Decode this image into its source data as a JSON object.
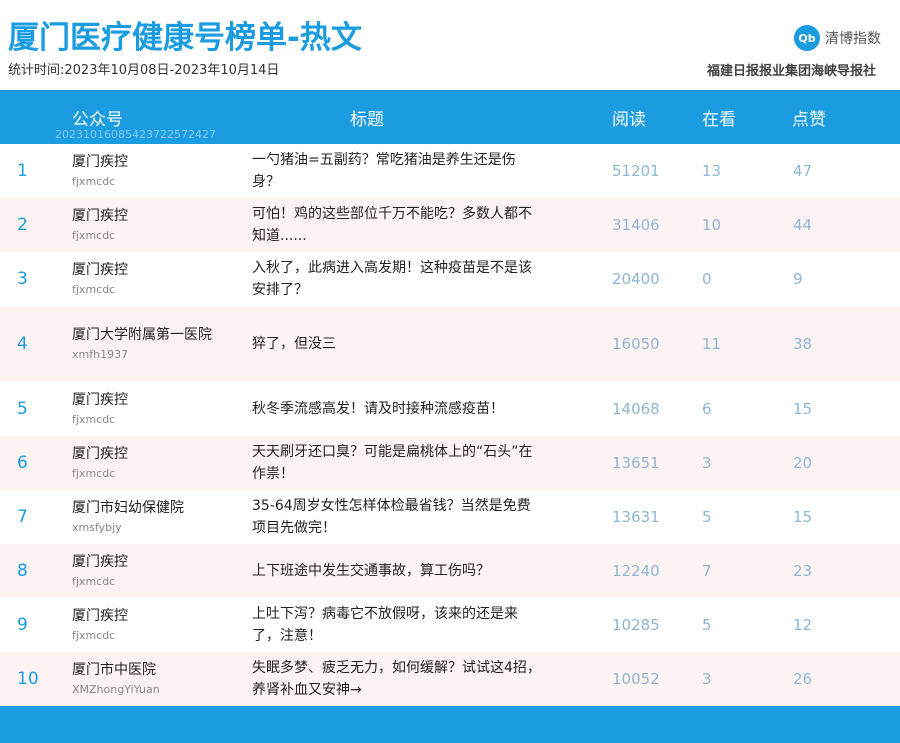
{
  "header": {
    "title": "厦门医疗健康号榜单-热文",
    "period": "统计时间:2023年10月08日-2023年10月14日",
    "logo_mark": "Qb",
    "logo_text": "清博指数",
    "publisher": "福建日报报业集团海峡导报社"
  },
  "table": {
    "columns": {
      "account": "公众号",
      "title": "标题",
      "reads": "阅读",
      "watching": "在看",
      "likes": "点赞"
    },
    "stamp": "20231016085423722572427",
    "rows": [
      {
        "rank": "1",
        "account": "厦门疾控",
        "account_id": "fjxmcdc",
        "title": "一勺猪油=五副药？常吃猪油是养生还是伤身？",
        "reads": "51201",
        "watching": "13",
        "likes": "47"
      },
      {
        "rank": "2",
        "account": "厦门疾控",
        "account_id": "fjxmcdc",
        "title": "可怕！鸡的这些部位千万不能吃？多数人都不知道......",
        "reads": "31406",
        "watching": "10",
        "likes": "44"
      },
      {
        "rank": "3",
        "account": "厦门疾控",
        "account_id": "fjxmcdc",
        "title": "入秋了，此病进入高发期！这种疫苗是不是该安排了？",
        "reads": "20400",
        "watching": "0",
        "likes": "9"
      },
      {
        "rank": "4",
        "account": "厦门大学附属第一医院",
        "account_id": "xmfh1937",
        "title": "猝了，但没三",
        "reads": "16050",
        "watching": "11",
        "likes": "38"
      },
      {
        "rank": "5",
        "account": "厦门疾控",
        "account_id": "fjxmcdc",
        "title": "秋冬季流感高发！请及时接种流感疫苗！",
        "reads": "14068",
        "watching": "6",
        "likes": "15"
      },
      {
        "rank": "6",
        "account": "厦门疾控",
        "account_id": "fjxmcdc",
        "title": "天天刷牙还口臭？可能是扁桃体上的“石头”在作祟！",
        "reads": "13651",
        "watching": "3",
        "likes": "20"
      },
      {
        "rank": "7",
        "account": "厦门市妇幼保健院",
        "account_id": "xmsfybjy",
        "title": "35-64周岁女性怎样体检最省钱？当然是免费项目先做完！",
        "reads": "13631",
        "watching": "5",
        "likes": "15"
      },
      {
        "rank": "8",
        "account": "厦门疾控",
        "account_id": "fjxmcdc",
        "title": "上下班途中发生交通事故，算工伤吗？",
        "reads": "12240",
        "watching": "7",
        "likes": "23"
      },
      {
        "rank": "9",
        "account": "厦门疾控",
        "account_id": "fjxmcdc",
        "title": "上吐下泻？病毒它不放假呀，该来的还是来了，注意！",
        "reads": "10285",
        "watching": "5",
        "likes": "12"
      },
      {
        "rank": "10",
        "account": "厦门市中医院",
        "account_id": "XMZhongYiYuan",
        "title": "失眠多梦、疲乏无力，如何缓解？试试这4招，养肾补血又安神→",
        "reads": "10052",
        "watching": "3",
        "likes": "26"
      }
    ]
  }
}
